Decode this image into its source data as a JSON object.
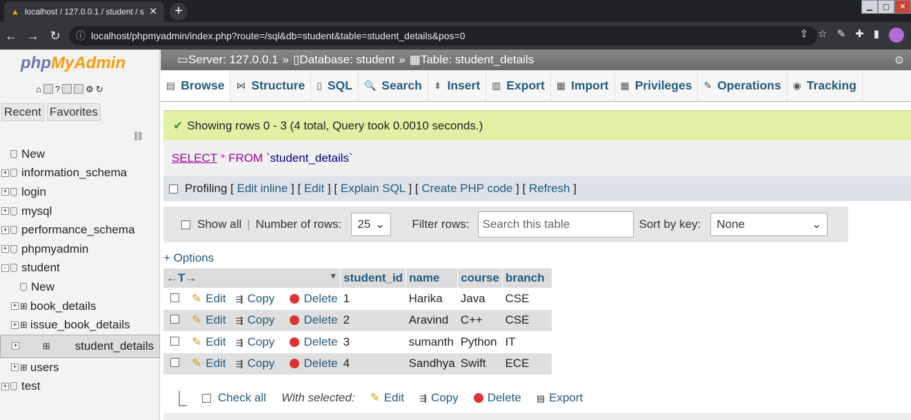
{
  "browser": {
    "tab_title": "localhost / 127.0.0.1 / student / s",
    "new_tab": "+",
    "url": "localhost/phpmyadmin/index.php?route=/sql&db=student&table=student_details&pos=0"
  },
  "sidebar": {
    "logo_a": "php",
    "logo_b": "MyAdmin",
    "recent": "Recent",
    "favorites": "Favorites",
    "tree": [
      {
        "label": "New",
        "level": 0,
        "exp": ""
      },
      {
        "label": "information_schema",
        "level": 0,
        "exp": "+"
      },
      {
        "label": "login",
        "level": 0,
        "exp": "+"
      },
      {
        "label": "mysql",
        "level": 0,
        "exp": "+"
      },
      {
        "label": "performance_schema",
        "level": 0,
        "exp": "+"
      },
      {
        "label": "phpmyadmin",
        "level": 0,
        "exp": "+"
      },
      {
        "label": "student",
        "level": 0,
        "exp": "-"
      },
      {
        "label": "New",
        "level": 1,
        "exp": ""
      },
      {
        "label": "book_details",
        "level": 1,
        "exp": "+"
      },
      {
        "label": "issue_book_details",
        "level": 1,
        "exp": "+"
      },
      {
        "label": "student_details",
        "level": 1,
        "exp": "+"
      },
      {
        "label": "users",
        "level": 1,
        "exp": "+"
      },
      {
        "label": "test",
        "level": 0,
        "exp": "+"
      }
    ]
  },
  "breadcrumb": {
    "server": "Server: 127.0.0.1",
    "database": "Database: student",
    "table": "Table: student_details",
    "sep": "»"
  },
  "tabs": [
    "Browse",
    "Structure",
    "SQL",
    "Search",
    "Insert",
    "Export",
    "Import",
    "Privileges",
    "Operations",
    "Tracking"
  ],
  "message": "Showing rows 0 - 3 (4 total, Query took 0.0010 seconds.)",
  "sql": {
    "select": "SELECT",
    "star": "*",
    "from": "FROM",
    "table": "`student_details`"
  },
  "profiling": {
    "label": "Profiling",
    "links": [
      "Edit inline",
      "Edit",
      "Explain SQL",
      "Create PHP code",
      "Refresh"
    ]
  },
  "filter": {
    "show_all": "Show all",
    "num_rows_label": "Number of rows:",
    "num_rows_value": "25",
    "filter_label": "Filter rows:",
    "filter_placeholder": "Search this table",
    "sort_label": "Sort by key:",
    "sort_value": "None"
  },
  "options_link": "+ Options",
  "table": {
    "headers": [
      "student_id",
      "name",
      "course",
      "branch"
    ],
    "actions": {
      "edit": "Edit",
      "copy": "Copy",
      "delete": "Delete"
    },
    "rows": [
      [
        "1",
        "Harika",
        "Java",
        "CSE"
      ],
      [
        "2",
        "Aravind",
        "C++",
        "CSE"
      ],
      [
        "3",
        "sumanth",
        "Python",
        "IT"
      ],
      [
        "4",
        "Sandhya",
        "Swift",
        "ECE"
      ]
    ]
  },
  "bottom": {
    "check_all": "Check all",
    "with_selected": "With selected:",
    "edit": "Edit",
    "copy": "Copy",
    "delete": "Delete",
    "export": "Export"
  }
}
